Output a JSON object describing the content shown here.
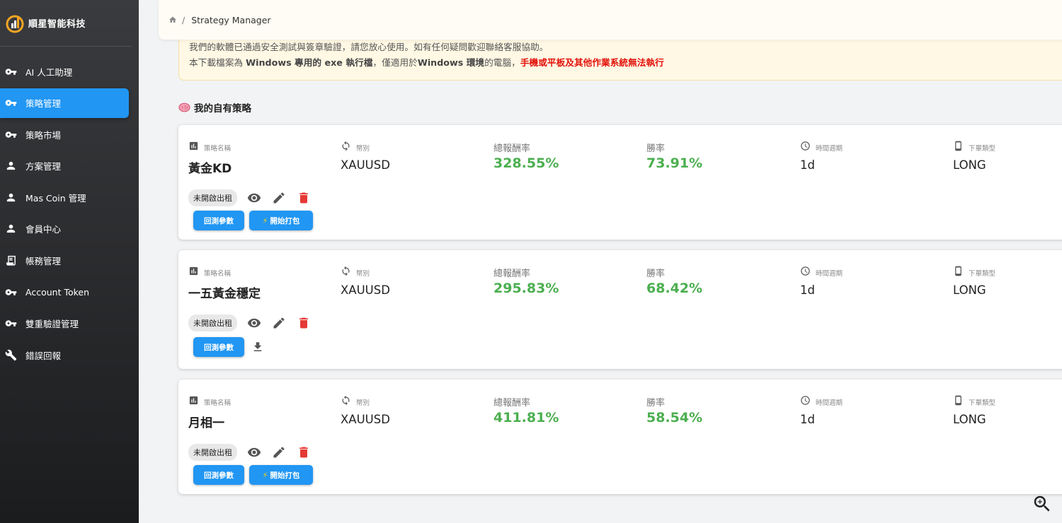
{
  "brand": {
    "name": "順星智能科技"
  },
  "sidebar": {
    "items": [
      {
        "label": "AI 人工助理",
        "icon": "key-icon",
        "active": false
      },
      {
        "label": "策略管理",
        "icon": "key-icon",
        "active": true
      },
      {
        "label": "策略市場",
        "icon": "key-icon",
        "active": false
      },
      {
        "label": "方案管理",
        "icon": "person-icon",
        "active": false
      },
      {
        "label": "Mas Coin 管理",
        "icon": "person-icon",
        "active": false
      },
      {
        "label": "會員中心",
        "icon": "person-icon",
        "active": false
      },
      {
        "label": "帳務管理",
        "icon": "receipt-icon",
        "active": false
      },
      {
        "label": "Account Token",
        "icon": "key-icon",
        "active": false
      },
      {
        "label": "雙重驗證管理",
        "icon": "key-icon",
        "active": false
      },
      {
        "label": "錯誤回報",
        "icon": "wrench-icon",
        "active": false
      }
    ]
  },
  "breadcrumb": {
    "separator": "/",
    "current": "Strategy Manager"
  },
  "notice": {
    "line1": "我們的軟體已通過安全測試與簽章驗證，請您放心使用。如有任何疑問歡迎聯絡客服協助。",
    "line2_a": "本下載檔案為 ",
    "line2_b": "Windows 專用的 exe 執行檔",
    "line2_c": "，僅適用於",
    "line2_d": "Windows 環境",
    "line2_e": "的電腦，",
    "line2_f": "手機或平板及其他作業系統無法執行"
  },
  "section": {
    "title": "我的自有策略"
  },
  "labels": {
    "name": "策略名稱",
    "symbol": "幣別",
    "return": "總報酬率",
    "winrate": "勝率",
    "period": "時間週期",
    "order_type": "下單類型",
    "rent_status": "未開啟出租",
    "backtest_btn": "回測參數",
    "package_btn": "開始打包"
  },
  "strategies": [
    {
      "name": "黃金KD",
      "symbol": "XAUUSD",
      "return": "328.55%",
      "winrate": "73.91%",
      "period": "1d",
      "order_type": "LONG",
      "has_package": true
    },
    {
      "name": "一五黃金穩定",
      "symbol": "XAUUSD",
      "return": "295.83%",
      "winrate": "68.42%",
      "period": "1d",
      "order_type": "LONG",
      "has_package": false
    },
    {
      "name": "月相一",
      "symbol": "XAUUSD",
      "return": "411.81%",
      "winrate": "58.54%",
      "period": "1d",
      "order_type": "LONG",
      "has_package": true
    }
  ],
  "colors": {
    "accent": "#2196f3",
    "positive": "#4caf50",
    "danger": "#e53935",
    "warning_text": "#e3120b"
  }
}
